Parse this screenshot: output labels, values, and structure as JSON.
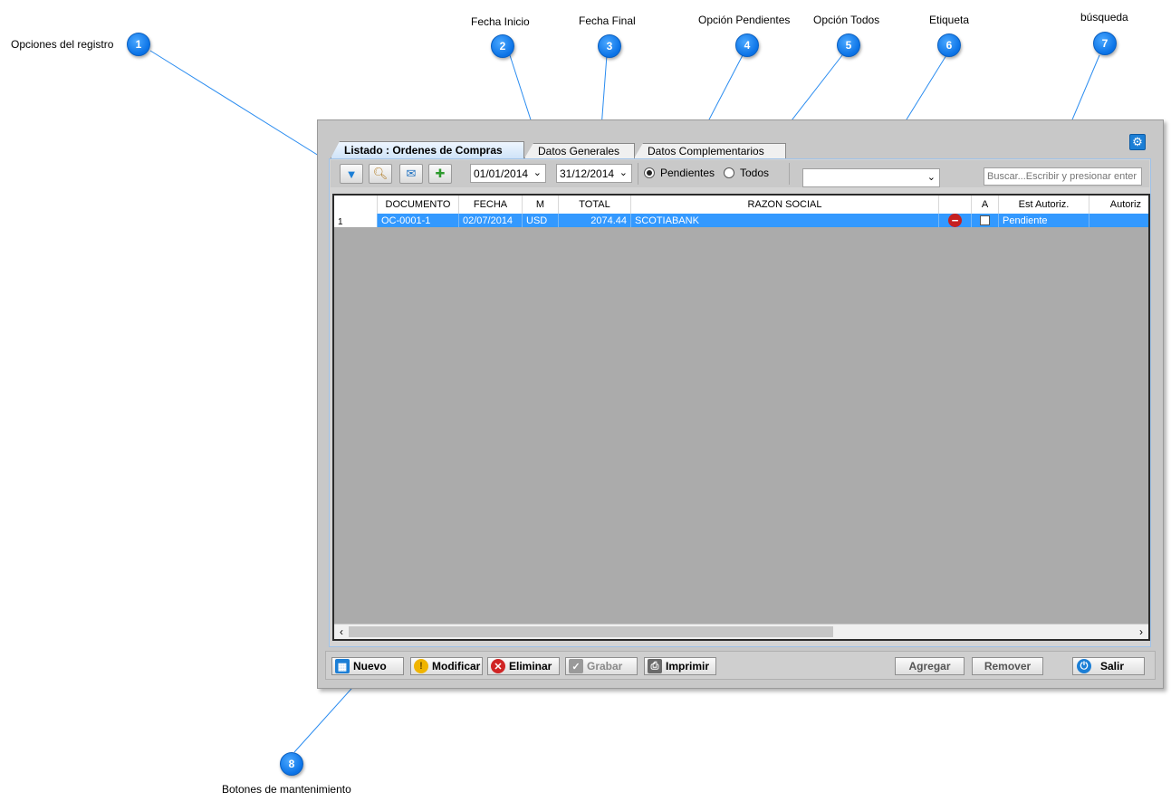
{
  "annotations": [
    {
      "number": "1",
      "label": "Opciones del registro"
    },
    {
      "number": "2",
      "label": "Fecha Inicio"
    },
    {
      "number": "3",
      "label": "Fecha Final"
    },
    {
      "number": "4",
      "label": "Opción Pendientes"
    },
    {
      "number": "5",
      "label": "Opción Todos"
    },
    {
      "number": "6",
      "label": "Etiqueta"
    },
    {
      "number": "7",
      "label": "búsqueda"
    },
    {
      "number": "8",
      "label": "Botones de mantenimiento"
    }
  ],
  "tabs": [
    {
      "label": "Listado : Ordenes de Compras",
      "active": true
    },
    {
      "label": "Datos Generales",
      "active": false
    },
    {
      "label": "Datos Complementarios",
      "active": false
    }
  ],
  "toolbar": {
    "tool_icons": [
      "filter-icon",
      "search-icon",
      "email-icon",
      "add-document-icon"
    ],
    "date_start": "01/01/2014",
    "date_end": "31/12/2014",
    "radio_pendientes": "Pendientes",
    "radio_todos": "Todos",
    "selected_option": "Pendientes",
    "label_select_value": "",
    "search_placeholder": "Buscar...Escribir y presionar enter"
  },
  "grid": {
    "columns": [
      "",
      "DOCUMENTO",
      "FECHA",
      "M",
      "TOTAL",
      "RAZON SOCIAL",
      "",
      "A",
      "Est Autoriz.",
      "Autoriz"
    ],
    "rows": [
      {
        "num": "1",
        "documento": "OC-0001-1",
        "fecha": "02/07/2014",
        "m": "USD",
        "total": "2074.44",
        "razon_social": "SCOTIABANK",
        "status_icon": "no-entry-icon",
        "a_checked": false,
        "est_autoriz": "Pendiente",
        "autoriz": ""
      }
    ]
  },
  "buttons": {
    "nuevo": "Nuevo",
    "modificar": "Modificar",
    "eliminar": "Eliminar",
    "grabar": "Grabar",
    "imprimir": "Imprimir",
    "agregar": "Agregar",
    "remover": "Remover",
    "salir": "Salir"
  },
  "colors": {
    "selection": "#3399ff",
    "badge": "#0a72e6",
    "delete_red": "#c62020"
  }
}
